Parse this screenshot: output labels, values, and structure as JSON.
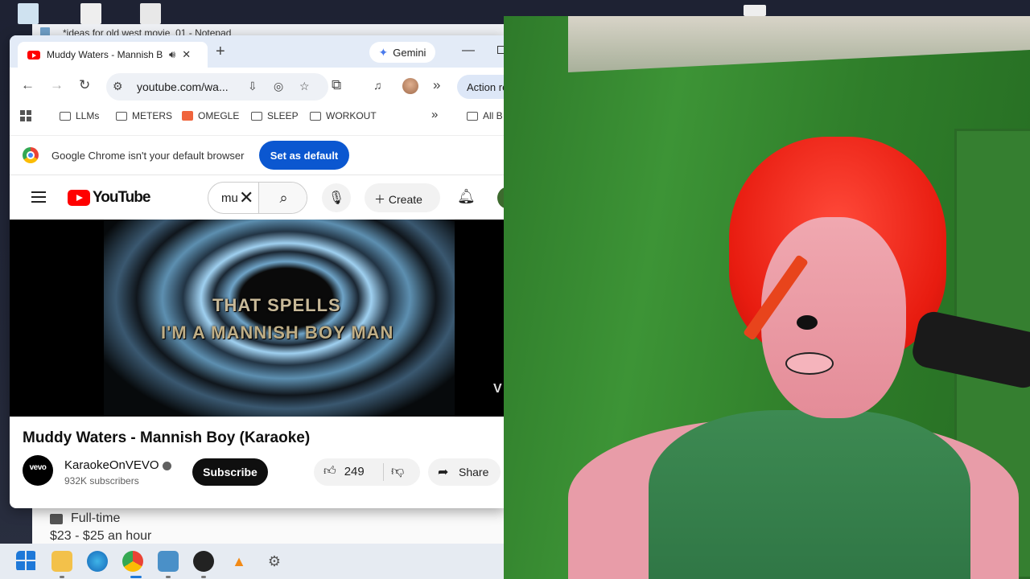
{
  "notepad": {
    "title": "*ideas for old west movie_01 - Notepad"
  },
  "bg_page": {
    "job_type": "Full-time",
    "pay": "$23 - $25 an hour"
  },
  "chrome": {
    "tab_title": "Muddy Waters - Mannish B",
    "gemini_label": "Gemini",
    "url": "youtube.com/wa...",
    "action_label": "Action re",
    "bookmarks": [
      "LLMs",
      "METERS",
      "OMEGLE",
      "SLEEP",
      "WORKOUT"
    ],
    "bookmarks_overflow": "»",
    "all_bookmarks": "All B",
    "infobar_text": "Google Chrome isn't your default browser",
    "set_default_label": "Set as default"
  },
  "youtube": {
    "logo_text": "YouTube",
    "search_value": "mu",
    "create_label": "Create",
    "lyrics": {
      "line1": "THAT SPELLS",
      "line2": "I'M A MANNISH BOY MAN"
    },
    "video_title": "Muddy Waters - Mannish Boy (Karaoke)",
    "channel_avatar_text": "vevo",
    "channel_name": "KaraokeOnVEVO",
    "subscribers": "932K subscribers",
    "subscribe_label": "Subscribe",
    "like_count": "249",
    "share_label": "Share"
  },
  "icons": {
    "tab_audio": "speaker-icon",
    "tab_close": "close-icon",
    "new_tab": "plus-icon",
    "back": "arrow-left-icon",
    "forward": "arrow-right-icon",
    "reload": "reload-icon",
    "search": "search-icon",
    "mic": "microphone-icon",
    "bell": "bell-icon"
  }
}
